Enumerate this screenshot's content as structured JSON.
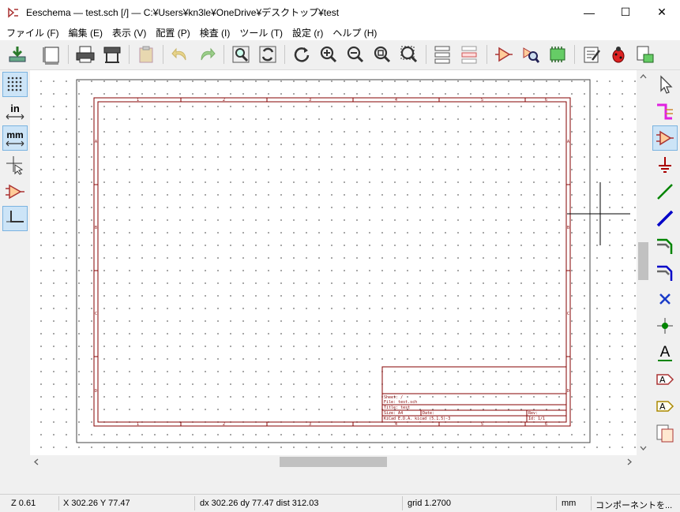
{
  "window": {
    "title": "Eeschema — test.sch [/] — C:¥Users¥kn3le¥OneDrive¥デスクトップ¥test",
    "minimize": "—",
    "maximize": "☐",
    "close": "✕"
  },
  "menu": [
    "ファイル (F)",
    "編集 (E)",
    "表示 (V)",
    "配置 (P)",
    "検査 (I)",
    "ツール (T)",
    "設定 (r)",
    "ヘルプ (H)"
  ],
  "toolbar": {
    "icons": [
      "save-icon",
      "page-settings-icon",
      "print-icon",
      "plot-icon",
      "paste-icon",
      "undo-icon",
      "redo-icon",
      "find-icon",
      "find-replace-icon",
      "redraw-icon",
      "zoom-in-icon",
      "zoom-out-icon",
      "zoom-fit-icon",
      "zoom-selection-icon",
      "hierarchy-navigator-icon",
      "leave-sheet-icon",
      "symbol-editor-icon",
      "symbol-browser-icon",
      "annotate-icon",
      "erc-icon",
      "netlist-icon",
      "bom-icon",
      "pcbnew-icon"
    ]
  },
  "left_toolbar": {
    "icons": [
      "grid-toggle-icon",
      "units-inch-icon",
      "units-mm-icon",
      "cursor-shape-icon",
      "hidden-pins-icon",
      "wire-angle-icon"
    ],
    "inch_label": "in",
    "mm_label": "mm"
  },
  "right_toolbar": {
    "icons": [
      "select-icon",
      "highlight-net-icon",
      "add-symbol-icon",
      "add-power-icon",
      "add-wire-icon",
      "add-bus-icon",
      "wire-bus-entry-icon",
      "bus-bus-entry-icon",
      "no-connect-icon",
      "junction-icon",
      "net-label-icon",
      "global-label-icon",
      "hierarchical-label-icon",
      "hierarchical-sheet-icon"
    ],
    "label_text": "A"
  },
  "title_block": {
    "sheet": "Sheet: /",
    "file": "File: test.sch",
    "title": "Title: test",
    "size": "Size: A4",
    "date": "Date:",
    "rev": "Rev:",
    "kicad": "KiCad E.D.A.  kicad (5.1.5)-3",
    "id": "Id: 1/1"
  },
  "border": {
    "columns": [
      "1",
      "2",
      "3",
      "4",
      "5",
      "6"
    ],
    "rows": [
      "A",
      "B",
      "C",
      "D"
    ]
  },
  "status": {
    "zoom": "Z 0.61",
    "xy": "X 302.26  Y 77.47",
    "delta": "dx 302.26  dy 77.47  dist 312.03",
    "grid": "grid 1.2700",
    "units": "mm",
    "mode": "コンポーネントを..."
  },
  "colors": {
    "border": "#840000",
    "wire": "#008400",
    "bus": "#0000c8",
    "accent": "#cce4f7"
  }
}
